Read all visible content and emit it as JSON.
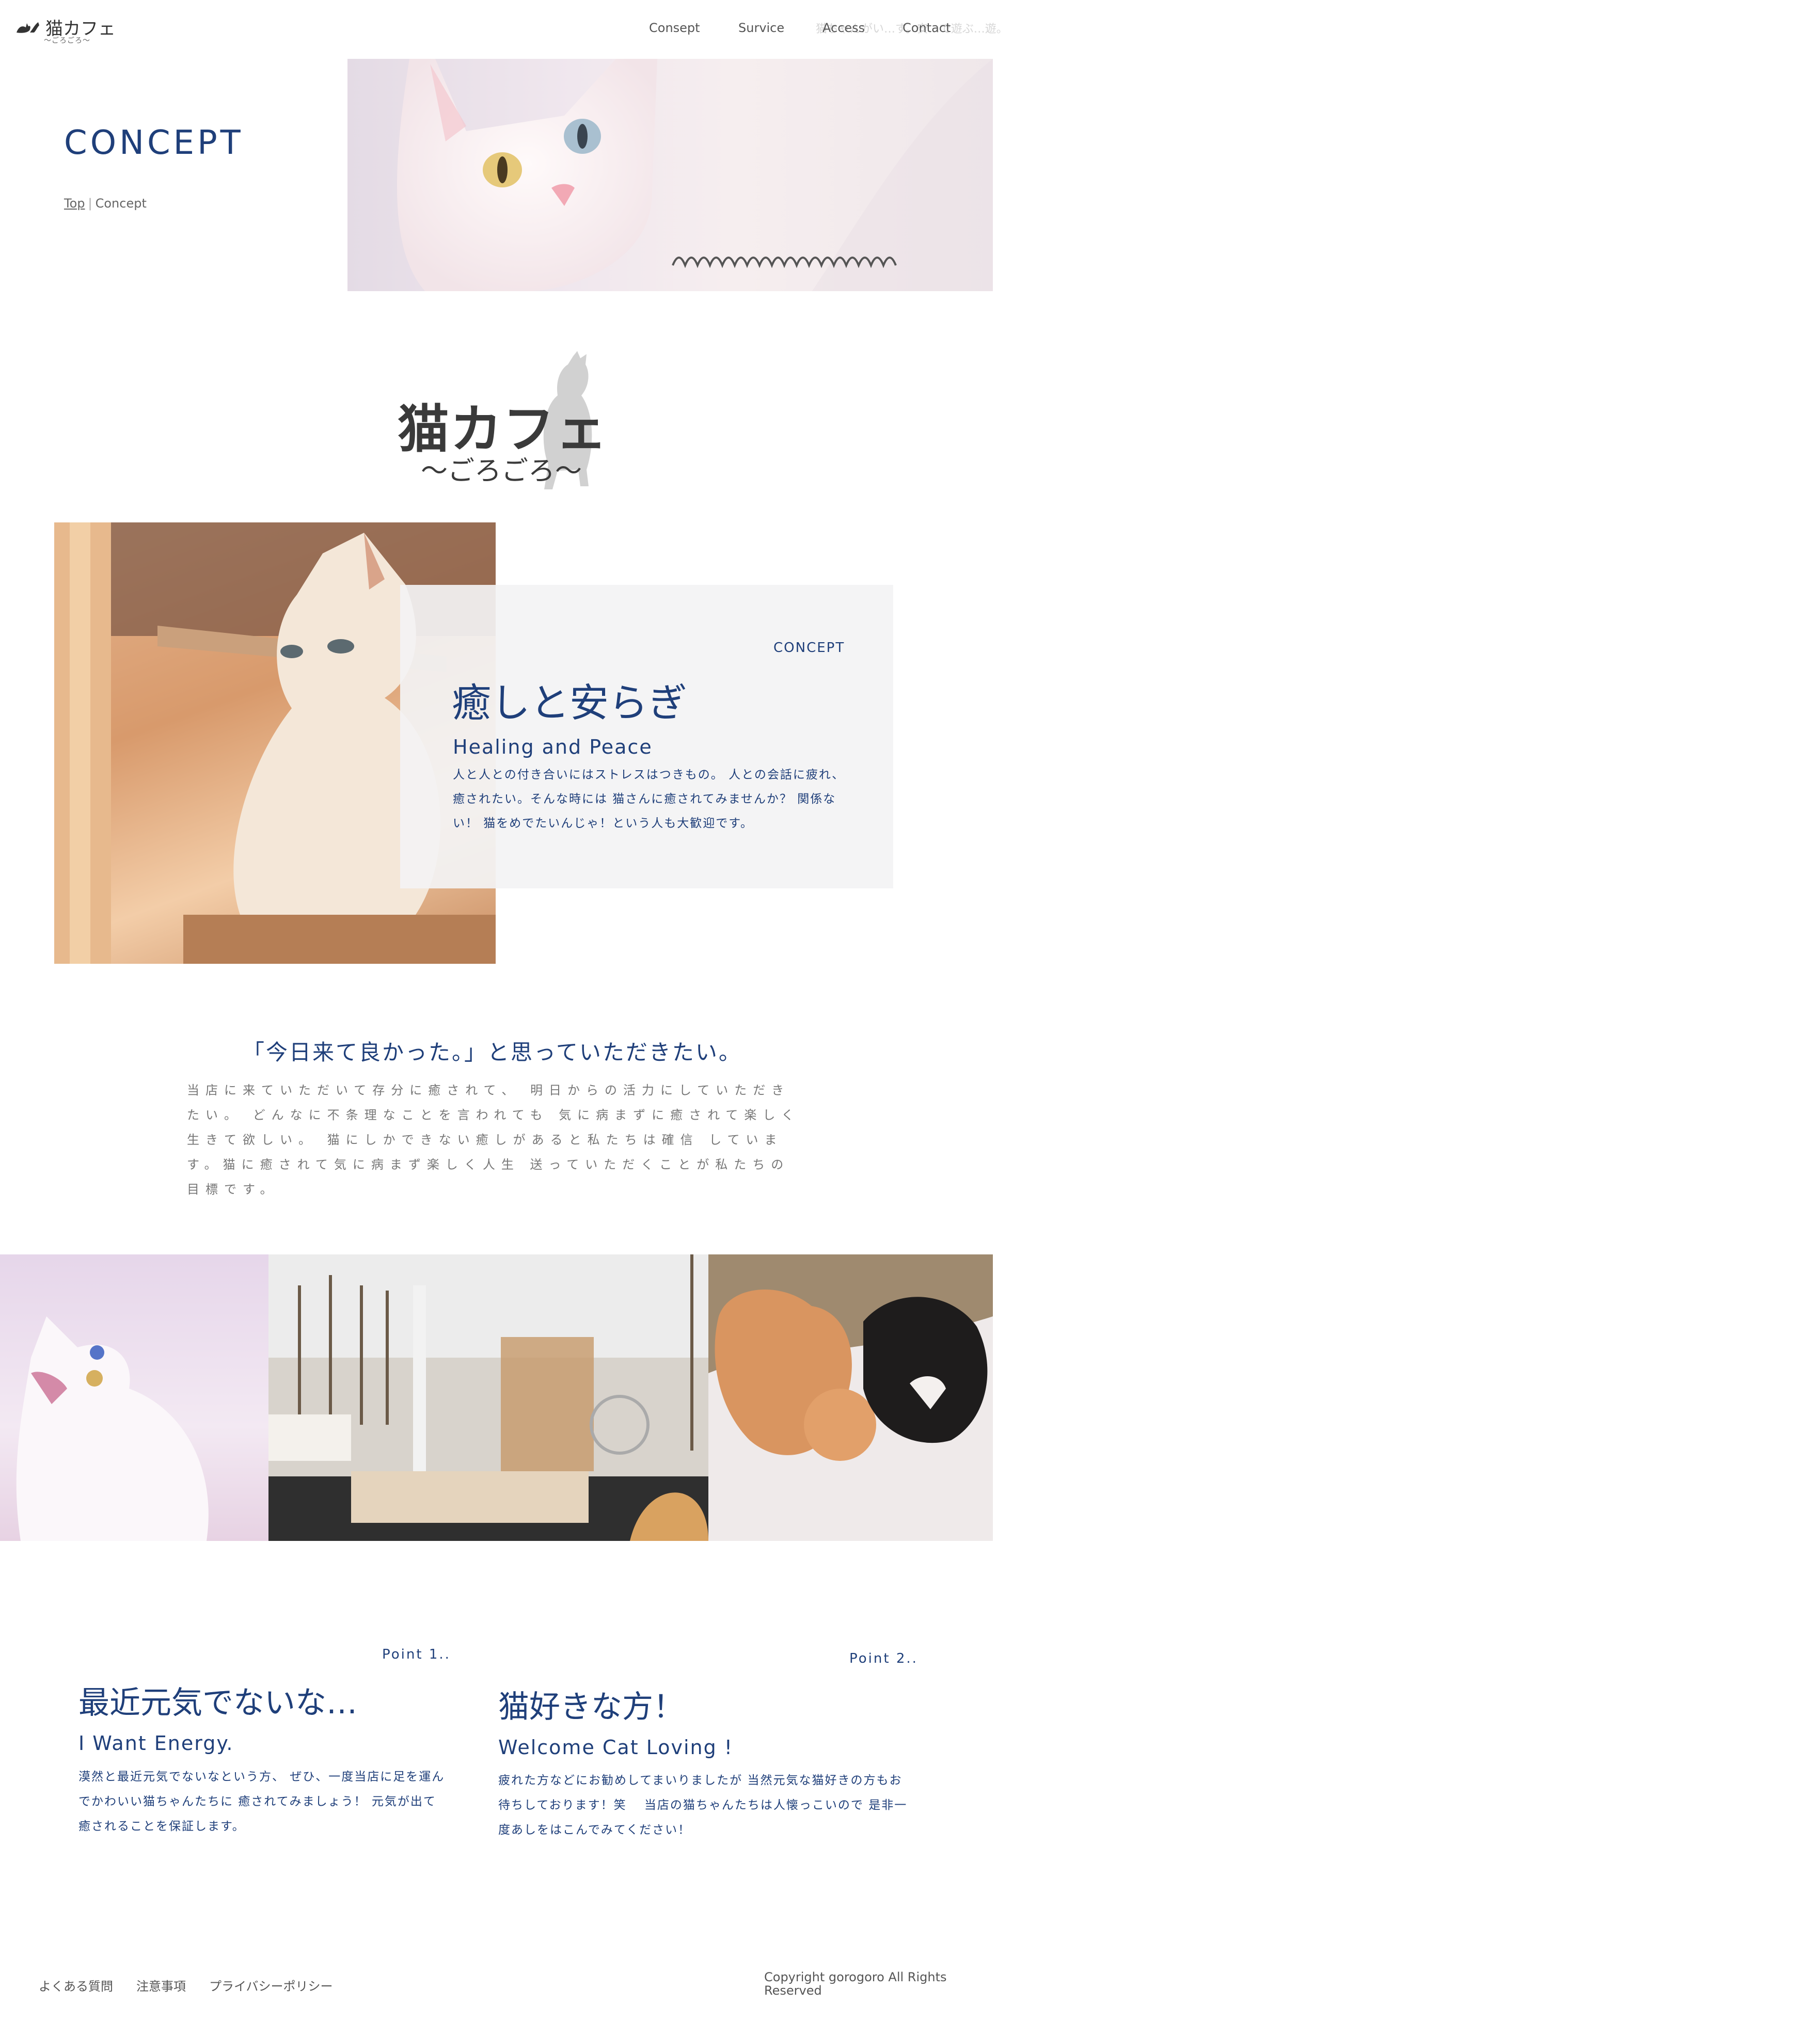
{
  "header": {
    "logo_text": "猫カフェ",
    "logo_sub": "〜ごろごろ〜",
    "nav": [
      "Consept",
      "Survice",
      "Access",
      "Contact"
    ],
    "nav_ghost": "猫ちゃんがい…す。安…で遊ぶ…遊。"
  },
  "hero": {
    "title": "CONCEPT",
    "breadcrumb_top": "Top",
    "breadcrumb_sep": "|",
    "breadcrumb_current": "Concept"
  },
  "brand": {
    "title": "猫カフェ",
    "subtitle": "〜ごろごろ〜"
  },
  "concept_card": {
    "eyebrow": "CONCEPT",
    "title": "癒しと安らぎ",
    "subtitle": "Healing and Peace",
    "body": "人と人との付き合いにはストレスはつきもの。 人との会話に疲れ、癒されたい。そんな時には 猫さんに癒されてみませんか？ 関係ない！ 猫をめでたいんじゃ！という人も大歓迎です。"
  },
  "message": {
    "title": "「今日来て良かった。」と思っていただきたい。",
    "body": "当店に来ていただいて存分に癒されて、 明日からの活力にしていただきたい。 どんなに不条理なことを言われても 気に病まずに癒されて楽しく生きて欲しい。 猫にしかできない癒しがあると私たちは確信 しています。猫に癒されて気に病まず楽しく人生 送っていただくことが私たちの目標です。"
  },
  "points": [
    {
      "eyebrow": "Point 1..",
      "title": "最近元気でないな…",
      "subtitle": "I Want Energy.",
      "body": "漠然と最近元気でないなという方、 ぜひ、一度当店に足を運んでかわいい猫ちゃんたちに 癒されてみましょう！ 元気が出て癒されることを保証します。"
    },
    {
      "eyebrow": "Point 2..",
      "title": "猫好きな方！",
      "subtitle": "Welcome Cat Loving !",
      "body": "疲れた方などにお勧めしてまいりましたが 当然元気な猫好きの方もお待ちしております！笑　 当店の猫ちゃんたちは人懐っこいので 是非一度あしをはこんでみてください！"
    }
  ],
  "footer": {
    "links": [
      "よくある質問",
      "注意事項",
      "プライバシーポリシー"
    ],
    "copyright": "Copyright gorogoro All Rights Reserved"
  }
}
